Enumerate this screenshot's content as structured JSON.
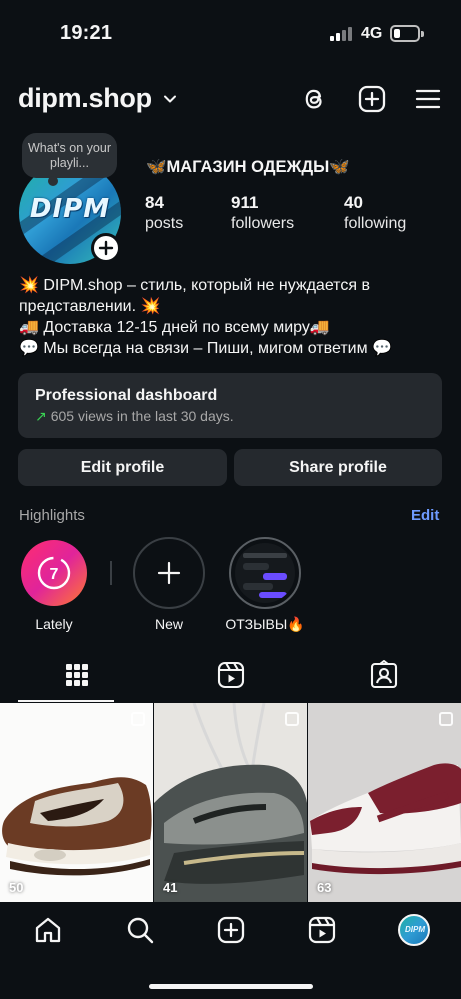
{
  "status_bar": {
    "time": "19:21",
    "network": "4G"
  },
  "header": {
    "username": "dipm.shop"
  },
  "profile": {
    "note": "What's on your playli...",
    "avatar_text": "DIPM",
    "title": "🦋МАГАЗИН ОДЕЖДЫ🦋",
    "stats": [
      {
        "value": "84",
        "label": "posts"
      },
      {
        "value": "911",
        "label": "followers"
      },
      {
        "value": "40",
        "label": "following"
      }
    ],
    "bio": [
      "💥 DIPM.shop – стиль, который не нуждается в представлении. 💥",
      "🚚 Доставка 12-15 дней по всему миру🚚",
      "💬 Мы всегда на связи – Пиши, мигом ответим 💬"
    ]
  },
  "dashboard": {
    "title": "Professional dashboard",
    "arrow": "↗",
    "subtitle": "605 views in the last 30 days."
  },
  "buttons": {
    "edit": "Edit profile",
    "share": "Share profile"
  },
  "highlights": {
    "title": "Highlights",
    "edit": "Edit",
    "items": [
      {
        "label": "Lately",
        "badge": "7"
      },
      {
        "label": "New"
      },
      {
        "label": "ОТЗЫВЫ🔥"
      }
    ]
  },
  "grid": [
    {
      "views": "50"
    },
    {
      "views": "41"
    },
    {
      "views": "63"
    }
  ],
  "colors": {
    "background": "#0c1014",
    "card": "#25292e",
    "link": "#6e9bff",
    "trend": "#39d353"
  }
}
